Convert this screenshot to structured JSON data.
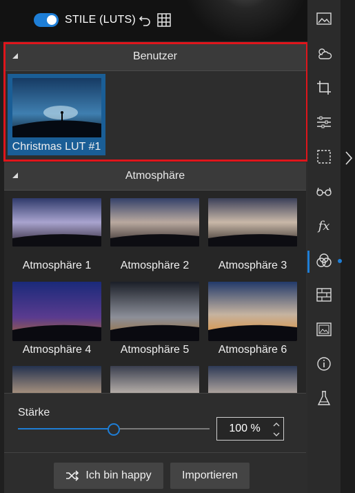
{
  "header": {
    "style_label": "STILE (LUTS)",
    "toggle_on": true
  },
  "sections": {
    "user": {
      "title": "Benutzer",
      "items": [
        {
          "label": "Christmas LUT #1",
          "selected": true
        }
      ]
    },
    "atmosphere": {
      "title": "Atmosphäre",
      "items": [
        {
          "label": "Atmosphäre 1"
        },
        {
          "label": "Atmosphäre 2"
        },
        {
          "label": "Atmosphäre 3"
        },
        {
          "label": "Atmosphäre 4"
        },
        {
          "label": "Atmosphäre 5"
        },
        {
          "label": "Atmosphäre 6"
        }
      ]
    }
  },
  "strength": {
    "label": "Stärke",
    "value_text": "100 %",
    "slider_fraction": 0.5
  },
  "buttons": {
    "happy": "Ich bin happy",
    "import": "Importieren"
  },
  "colors": {
    "accent": "#1e7ed6",
    "highlight_outline": "#e0151b"
  },
  "sidebar_icons": [
    "landscape-icon",
    "weather-icon",
    "crop-icon",
    "sliders-icon",
    "selection-icon",
    "glasses-icon",
    "fx-icon",
    "styles-icon",
    "texture-icon",
    "image-icon",
    "info-icon",
    "flask-icon"
  ]
}
